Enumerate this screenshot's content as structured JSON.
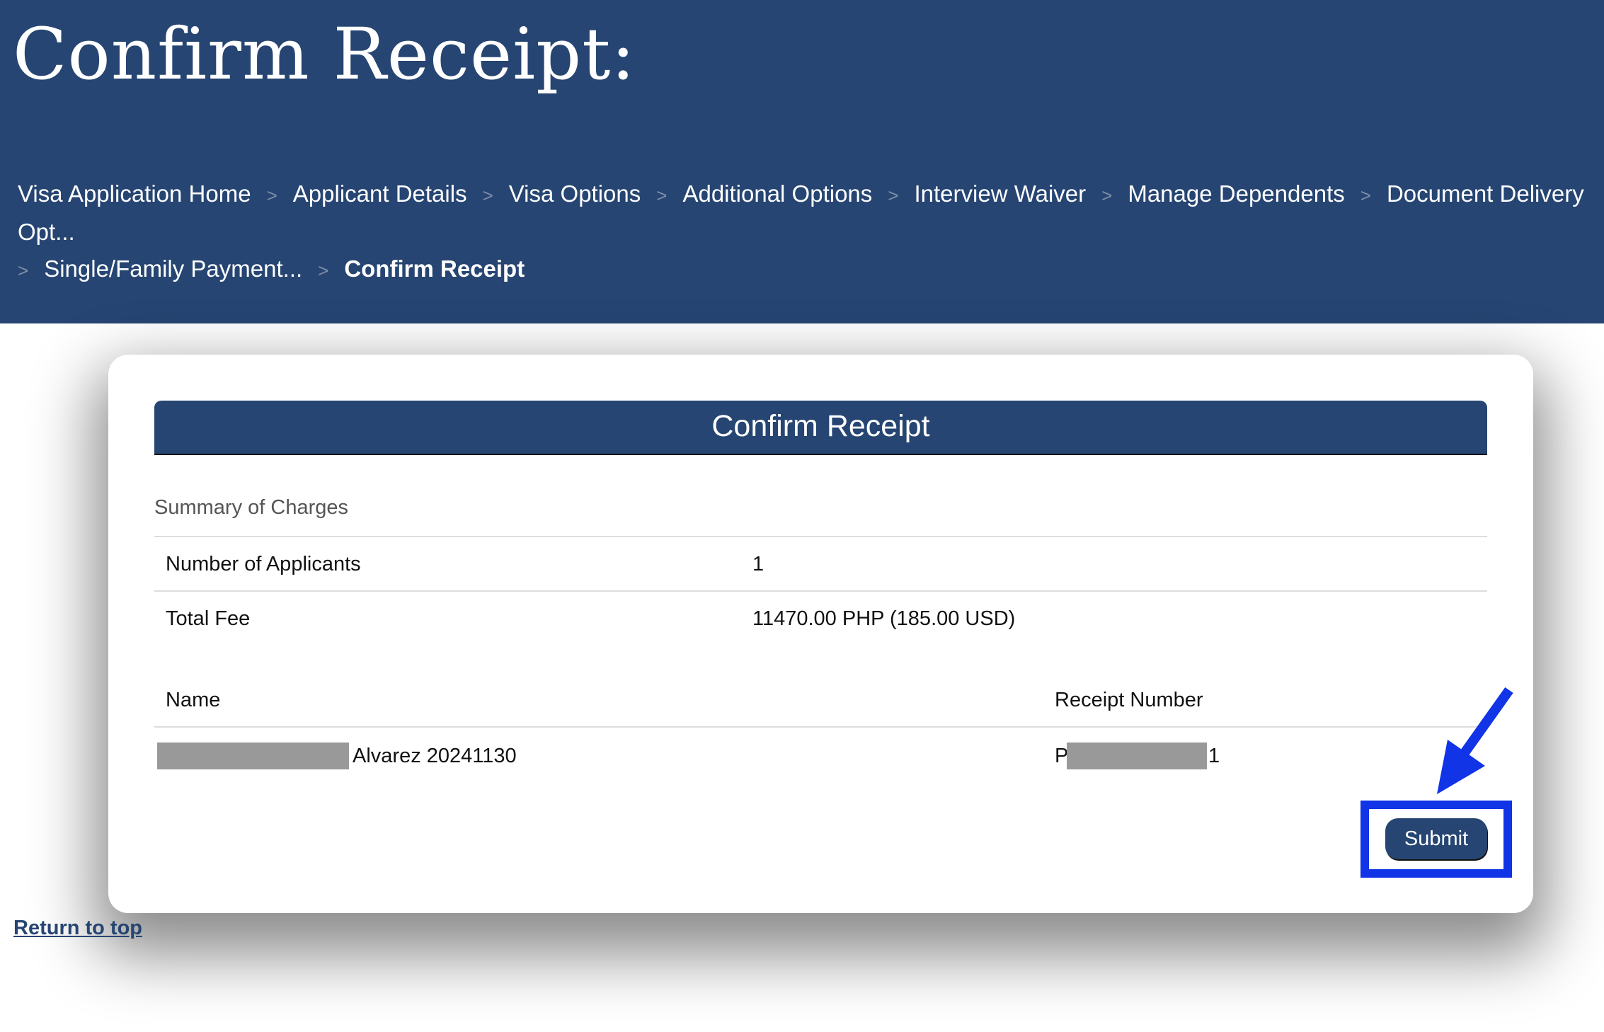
{
  "header": {
    "title": "Confirm Receipt:",
    "breadcrumb": [
      "Visa Application Home",
      "Applicant Details",
      "Visa Options",
      "Additional Options",
      "Interview Waiver",
      "Manage Dependents",
      "Document Delivery Opt...",
      "Single/Family Payment...",
      "Confirm Receipt"
    ],
    "separator": ">"
  },
  "card": {
    "title": "Confirm Receipt",
    "summary_label": "Summary of Charges",
    "charges": [
      {
        "label": "Number of Applicants",
        "value": "1"
      },
      {
        "label": "Total Fee",
        "value": "11470.00 PHP (185.00 USD)"
      }
    ],
    "table": {
      "headers": [
        "Name",
        "Receipt Number"
      ],
      "rows": [
        {
          "name_suffix": "Alvarez 20241130",
          "receipt_prefix": "P",
          "receipt_suffix": "1"
        }
      ]
    },
    "submit_label": "Submit"
  },
  "footer": {
    "return_to_top": "Return to top"
  },
  "colors": {
    "brand": "#264572",
    "annotation": "#1034e6",
    "redaction": "#999999"
  }
}
